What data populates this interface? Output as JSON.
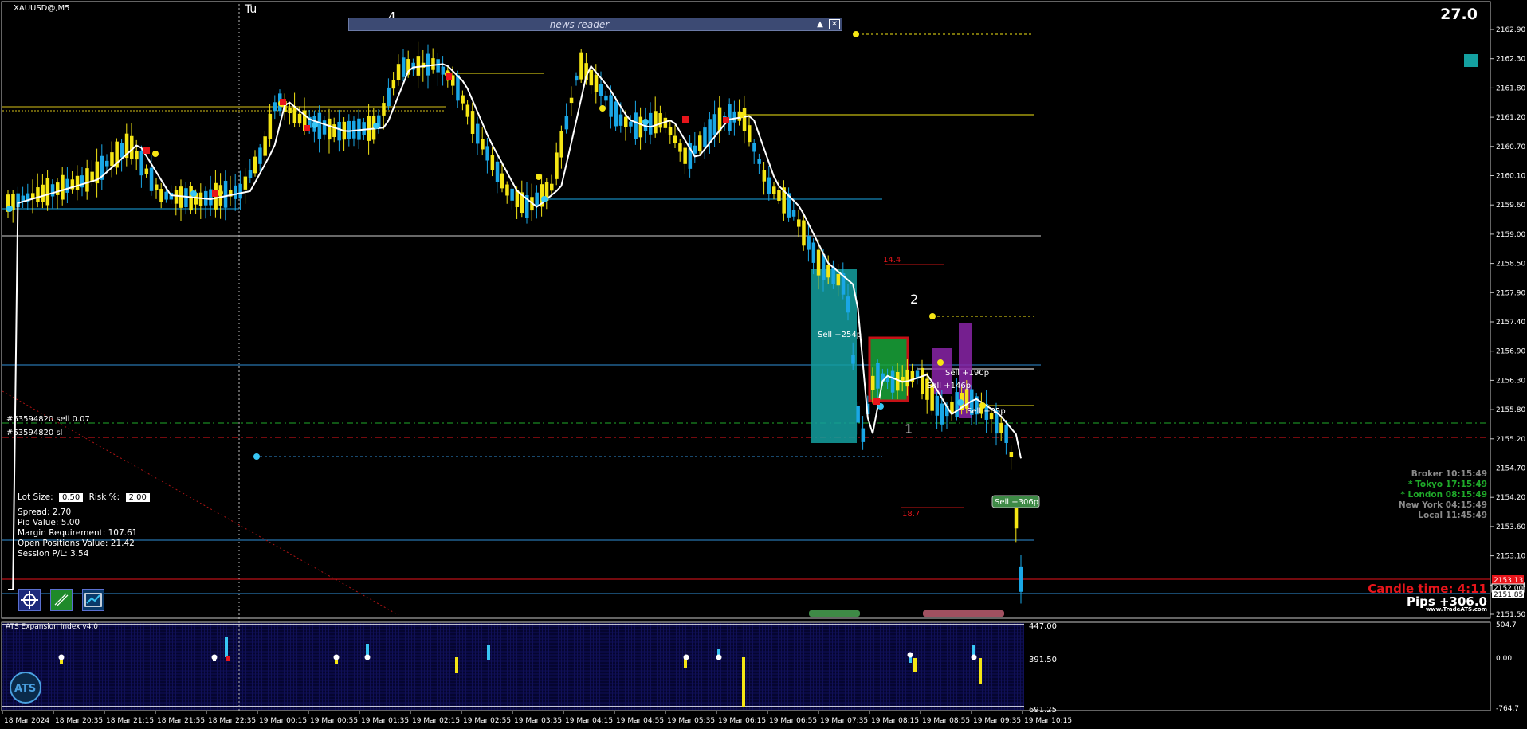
{
  "window": {
    "symbol_title": "XAUUSD@,M5",
    "corner_value": "27.0"
  },
  "session_marks": {
    "tuesday": "Tu",
    "wave_4": "4",
    "wave_2": "2",
    "wave_1": "1"
  },
  "news_reader": {
    "title": "news reader",
    "minimize_icon": "triangle-up-icon",
    "close_icon": "close-x-icon"
  },
  "price_axis": {
    "labels": [
      "2162.90",
      "2162.30",
      "2161.80",
      "2161.20",
      "2160.70",
      "2160.10",
      "2159.60",
      "2159.00",
      "2158.50",
      "2157.90",
      "2157.40",
      "2156.90",
      "2156.30",
      "2155.80",
      "2155.20",
      "2154.70",
      "2154.20",
      "2153.60",
      "2153.10",
      "2152.50",
      "2151.50"
    ],
    "current_price_red": "2153.13",
    "current_price_a": "2152.00",
    "current_price_b": "2151.85"
  },
  "indicator_axis": {
    "labels": [
      "504.7",
      "0.00",
      "-764.7"
    ],
    "inner_labels": [
      "447.00",
      "391.50",
      "691.25"
    ]
  },
  "time_axis": {
    "labels": [
      "18 Mar 2024",
      "18 Mar 20:35",
      "18 Mar 21:15",
      "18 Mar 21:55",
      "18 Mar 22:35",
      "19 Mar 00:15",
      "19 Mar 00:55",
      "19 Mar 01:35",
      "19 Mar 02:15",
      "19 Mar 02:55",
      "19 Mar 03:35",
      "19 Mar 04:15",
      "19 Mar 04:55",
      "19 Mar 05:35",
      "19 Mar 06:15",
      "19 Mar 06:55",
      "19 Mar 07:35",
      "19 Mar 08:15",
      "19 Mar 08:55",
      "19 Mar 09:35",
      "19 Mar 10:15"
    ]
  },
  "order_lines": {
    "sell_order": "#63594820 sell 0.07",
    "sl_order": "#63594820 sl"
  },
  "trade_labels": {
    "sell_254": "Sell +254p",
    "sell_190": "Sell +190p",
    "sell_146": "Sell +146p",
    "sell_35": "Sell +35p",
    "sell_306": "Sell +306p",
    "level_14": "14.4",
    "level_18": "18.7"
  },
  "info_panel": {
    "lot_size_label": "Lot Size:",
    "lot_size_value": "0.50",
    "risk_label": "Risk %:",
    "risk_value": "2.00",
    "spread": "Spread: 2.70",
    "pip_value": "Pip Value: 5.00",
    "margin": "Margin Requirement: 107.61",
    "open_positions": "Open Positions Value: 21.42",
    "session_pl": "Session P/L: 3.54"
  },
  "sessions": [
    {
      "name": "Broker",
      "time": "10:15:49",
      "color": "#8a8a8a"
    },
    {
      "name": "* Tokyo",
      "time": "17:15:49",
      "color": "#1faa2a"
    },
    {
      "name": "* London",
      "time": "08:15:49",
      "color": "#1faa2a"
    },
    {
      "name": "New York",
      "time": "04:15:49",
      "color": "#8a8a8a"
    },
    {
      "name": "Local",
      "time": "11:45:49",
      "color": "#8a8a8a"
    }
  ],
  "status": {
    "candle_time": "Candle time:  4:11",
    "pips": "Pips +306.0",
    "website": "www.TradeATS.com"
  },
  "indicator": {
    "title": "ATS Expansion Index v4.0",
    "logo_text": "ATS"
  },
  "toolbar": {
    "icons": [
      "crosshair-target-icon",
      "link-chain-icon",
      "chart-trend-icon"
    ]
  },
  "colors": {
    "up_candle": "#1aa7e6",
    "down_candle": "#f5e614",
    "ma_line": "#ffffff",
    "accent_teal": "#14a0a0",
    "sl_red": "#e8151b"
  }
}
